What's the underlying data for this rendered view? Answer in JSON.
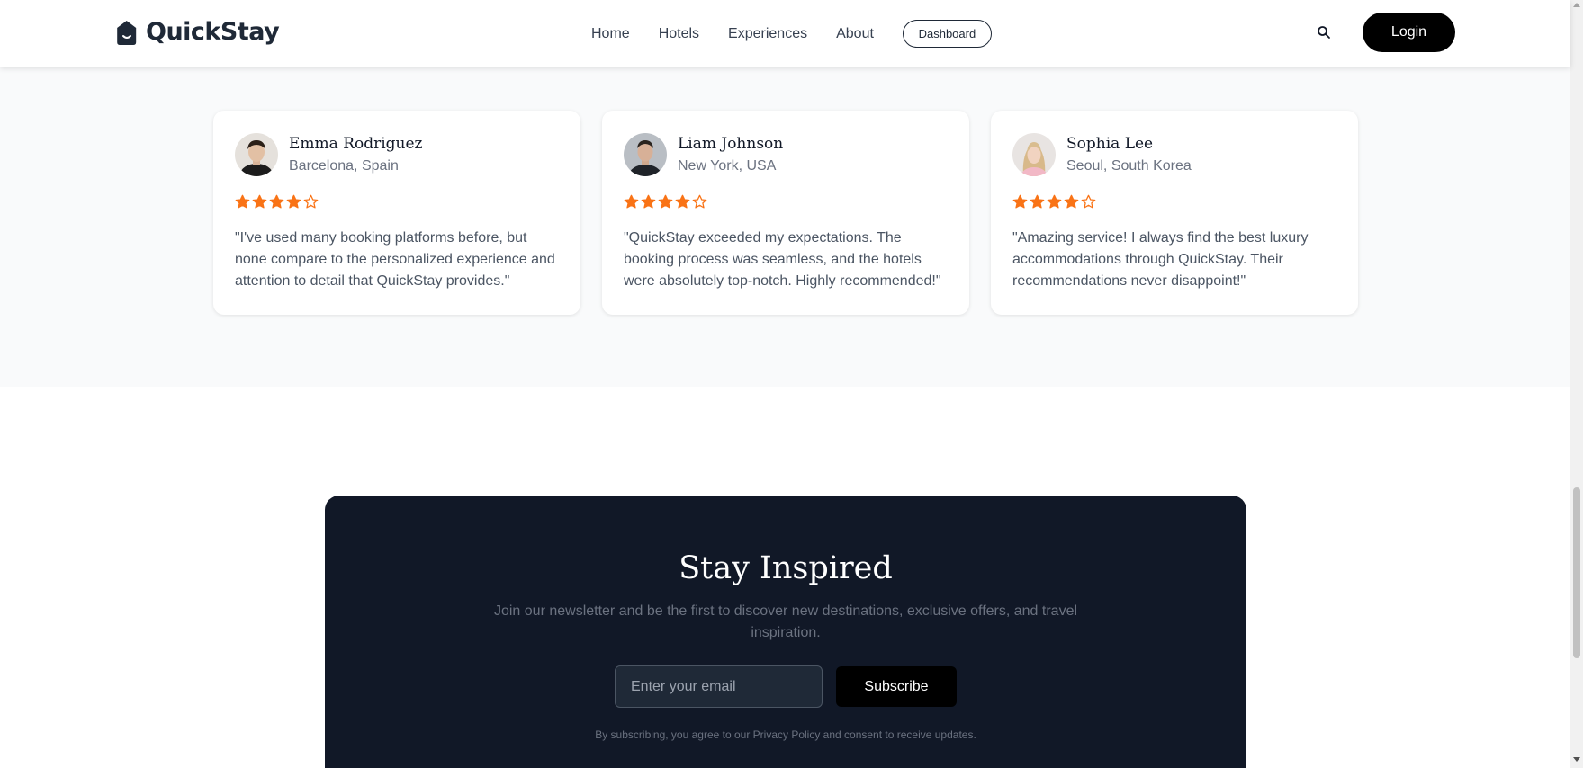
{
  "brand": {
    "name": "QuickStay"
  },
  "nav": {
    "items": [
      "Home",
      "Hotels",
      "Experiences",
      "About"
    ],
    "dashboard_label": "Dashboard",
    "login_label": "Login"
  },
  "testimonials": [
    {
      "name": "Emma Rodriguez",
      "location": "Barcelona, Spain",
      "rating": 4,
      "quote": "\"I've used many booking platforms before, but none compare to the personalized experience and attention to detail that QuickStay provides.\""
    },
    {
      "name": "Liam Johnson",
      "location": "New York, USA",
      "rating": 4,
      "quote": "\"QuickStay exceeded my expectations. The booking process was seamless, and the hotels were absolutely top-notch. Highly recommended!\""
    },
    {
      "name": "Sophia Lee",
      "location": "Seoul, South Korea",
      "rating": 4,
      "quote": "\"Amazing service! I always find the best luxury accommodations through QuickStay. Their recommendations never disappoint!\""
    }
  ],
  "newsletter": {
    "title": "Stay Inspired",
    "subtitle": "Join our newsletter and be the first to discover new destinations, exclusive offers, and travel inspiration.",
    "email_placeholder": "Enter your email",
    "subscribe_label": "Subscribe",
    "legal": "By subscribing, you agree to our Privacy Policy and consent to receive updates."
  },
  "colors": {
    "star": "#f97316",
    "newsletter_bg": "#111827",
    "section_bg": "#f9fafb"
  },
  "icons": [
    "logo-icon",
    "search-icon",
    "star-icon"
  ]
}
